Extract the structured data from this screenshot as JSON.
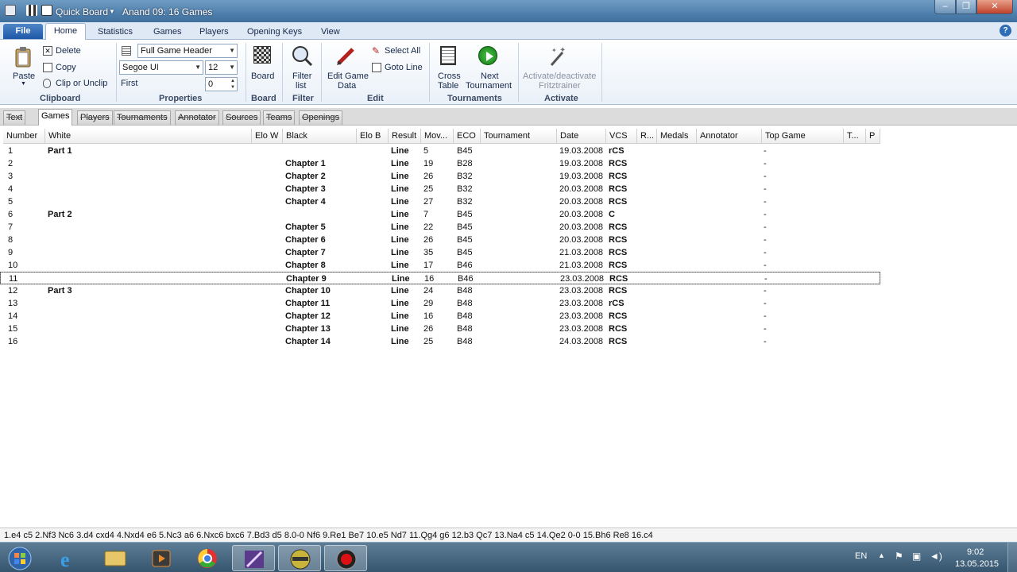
{
  "window": {
    "app_name": "Quick Board",
    "title": "Anand 09:  16 Games",
    "min_label": "–",
    "max_label": "❐",
    "close_label": "✕"
  },
  "ribbon_tabs": [
    "File",
    "Home",
    "Statistics",
    "Games",
    "Players",
    "Opening Keys",
    "View"
  ],
  "ribbon": {
    "clipboard": {
      "title": "Clipboard",
      "paste": "Paste",
      "delete": "Delete",
      "copy": "Copy",
      "clip_or_unclip": "Clip or Unclip"
    },
    "properties": {
      "title": "Properties",
      "header_combo": "Full Game Header",
      "font_combo": "Segoe UI",
      "size_combo": "12",
      "first_label": "First",
      "first_value": "0"
    },
    "board": {
      "title": "Board",
      "board": "Board"
    },
    "filter": {
      "title": "Filter",
      "filter_list_1": "Filter",
      "filter_list_2": "list"
    },
    "edit": {
      "title": "Edit",
      "edit_game_data_1": "Edit Game",
      "edit_game_data_2": "Data",
      "select_all": "Select All",
      "goto_line": "Goto Line"
    },
    "tournaments": {
      "title": "Tournaments",
      "cross_table_1": "Cross",
      "cross_table_2": "Table",
      "next_tournament_1": "Next",
      "next_tournament_2": "Tournament"
    },
    "activate": {
      "title": "Activate",
      "fritztrainer_1": "Activate/deactivate",
      "fritztrainer_2": "Fritztrainer"
    }
  },
  "sub_tabs": [
    "Text",
    "Games",
    "Players",
    "Tournaments",
    "Annotator",
    "Sources",
    "Teams",
    "Openings"
  ],
  "columns": [
    "Number",
    "White",
    "Elo W",
    "Black",
    "Elo B",
    "Result",
    "Mov...",
    "ECO",
    "Tournament",
    "Date",
    "VCS",
    "R...",
    "Medals",
    "Annotator",
    "Top Game",
    "T...",
    "P"
  ],
  "games": [
    {
      "num": "1",
      "white": "Part 1",
      "black": "",
      "result": "Line",
      "moves": "5",
      "eco": "B45",
      "date": "19.03.2008",
      "vcs": "rCS",
      "top": "-"
    },
    {
      "num": "2",
      "white": "",
      "black": "Chapter 1",
      "result": "Line",
      "moves": "19",
      "eco": "B28",
      "date": "19.03.2008",
      "vcs": "RCS",
      "top": "-"
    },
    {
      "num": "3",
      "white": "",
      "black": "Chapter 2",
      "result": "Line",
      "moves": "26",
      "eco": "B32",
      "date": "19.03.2008",
      "vcs": "RCS",
      "top": "-"
    },
    {
      "num": "4",
      "white": "",
      "black": "Chapter 3",
      "result": "Line",
      "moves": "25",
      "eco": "B32",
      "date": "20.03.2008",
      "vcs": "RCS",
      "top": "-"
    },
    {
      "num": "5",
      "white": "",
      "black": "Chapter 4",
      "result": "Line",
      "moves": "27",
      "eco": "B32",
      "date": "20.03.2008",
      "vcs": "RCS",
      "top": "-"
    },
    {
      "num": "6",
      "white": "Part 2",
      "black": "",
      "result": "Line",
      "moves": "7",
      "eco": "B45",
      "date": "20.03.2008",
      "vcs": "C",
      "top": "-"
    },
    {
      "num": "7",
      "white": "",
      "black": "Chapter 5",
      "result": "Line",
      "moves": "22",
      "eco": "B45",
      "date": "20.03.2008",
      "vcs": "RCS",
      "top": "-"
    },
    {
      "num": "8",
      "white": "",
      "black": "Chapter 6",
      "result": "Line",
      "moves": "26",
      "eco": "B45",
      "date": "20.03.2008",
      "vcs": "RCS",
      "top": "-"
    },
    {
      "num": "9",
      "white": "",
      "black": "Chapter 7",
      "result": "Line",
      "moves": "35",
      "eco": "B45",
      "date": "21.03.2008",
      "vcs": "RCS",
      "top": "-"
    },
    {
      "num": "10",
      "white": "",
      "black": "Chapter 8",
      "result": "Line",
      "moves": "17",
      "eco": "B46",
      "date": "21.03.2008",
      "vcs": "RCS",
      "top": "-"
    },
    {
      "num": "11",
      "white": "",
      "black": "Chapter 9",
      "result": "Line",
      "moves": "16",
      "eco": "B46",
      "date": "23.03.2008",
      "vcs": "RCS",
      "top": "-"
    },
    {
      "num": "12",
      "white": "Part 3",
      "black": "Chapter 10",
      "result": "Line",
      "moves": "24",
      "eco": "B48",
      "date": "23.03.2008",
      "vcs": "RCS",
      "top": "-"
    },
    {
      "num": "13",
      "white": "",
      "black": "Chapter 11",
      "result": "Line",
      "moves": "29",
      "eco": "B48",
      "date": "23.03.2008",
      "vcs": "rCS",
      "top": "-"
    },
    {
      "num": "14",
      "white": "",
      "black": "Chapter 12",
      "result": "Line",
      "moves": "16",
      "eco": "B48",
      "date": "23.03.2008",
      "vcs": "RCS",
      "top": "-"
    },
    {
      "num": "15",
      "white": "",
      "black": "Chapter 13",
      "result": "Line",
      "moves": "26",
      "eco": "B48",
      "date": "23.03.2008",
      "vcs": "RCS",
      "top": "-"
    },
    {
      "num": "16",
      "white": "",
      "black": "Chapter 14",
      "result": "Line",
      "moves": "25",
      "eco": "B48",
      "date": "24.03.2008",
      "vcs": "RCS",
      "top": "-"
    }
  ],
  "focused_row": "11",
  "moves_line": "1.e4 c5 2.Nf3 Nc6 3.d4 cxd4 4.Nxd4 e6 5.Nc3 a6 6.Nxc6 bxc6 7.Bd3 d5 8.0-0 Nf6 9.Re1 Be7 10.e5 Nd7 11.Qg4 g6 12.b3 Qc7 13.Na4 c5 14.Qe2 0-0 15.Bh6 Re8 16.c4",
  "taskbar": {
    "language": "EN",
    "time": "9:02",
    "date": "13.05.2015"
  },
  "colors": {
    "title_bar": "#4f80ad",
    "ribbon_bg": "#e9f0f8",
    "file_tab": "#1d58a8",
    "taskbar": "#35556f"
  }
}
